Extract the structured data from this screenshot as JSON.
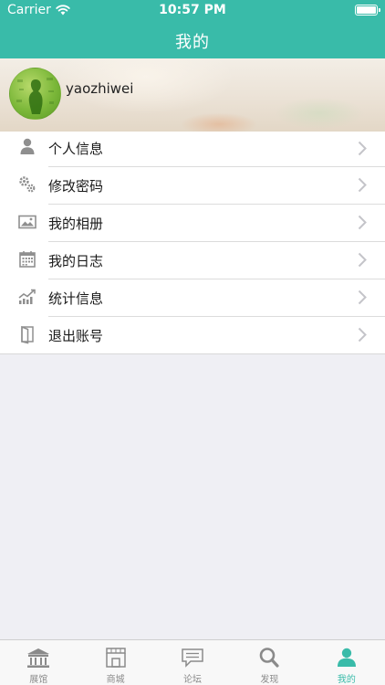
{
  "status_bar": {
    "carrier": "Carrier",
    "time": "10:57 PM"
  },
  "nav": {
    "title": "我的"
  },
  "profile": {
    "username": "yaozhiwei"
  },
  "menu": {
    "items": [
      {
        "label": "个人信息",
        "icon": "person-icon"
      },
      {
        "label": "修改密码",
        "icon": "gears-icon"
      },
      {
        "label": "我的相册",
        "icon": "photo-icon"
      },
      {
        "label": "我的日志",
        "icon": "calendar-icon"
      },
      {
        "label": "统计信息",
        "icon": "stats-icon"
      },
      {
        "label": "退出账号",
        "icon": "logout-door-icon"
      }
    ]
  },
  "tabbar": {
    "items": [
      {
        "label": "展馆",
        "icon": "pavilion-icon",
        "active": false
      },
      {
        "label": "商城",
        "icon": "store-icon",
        "active": false
      },
      {
        "label": "论坛",
        "icon": "chat-icon",
        "active": false
      },
      {
        "label": "发现",
        "icon": "magnifier-icon",
        "active": false
      },
      {
        "label": "我的",
        "icon": "user-icon",
        "active": true
      }
    ]
  },
  "colors": {
    "accent": "#39bba9",
    "background": "#efeff4",
    "tab_inactive": "#8a8a8a"
  }
}
